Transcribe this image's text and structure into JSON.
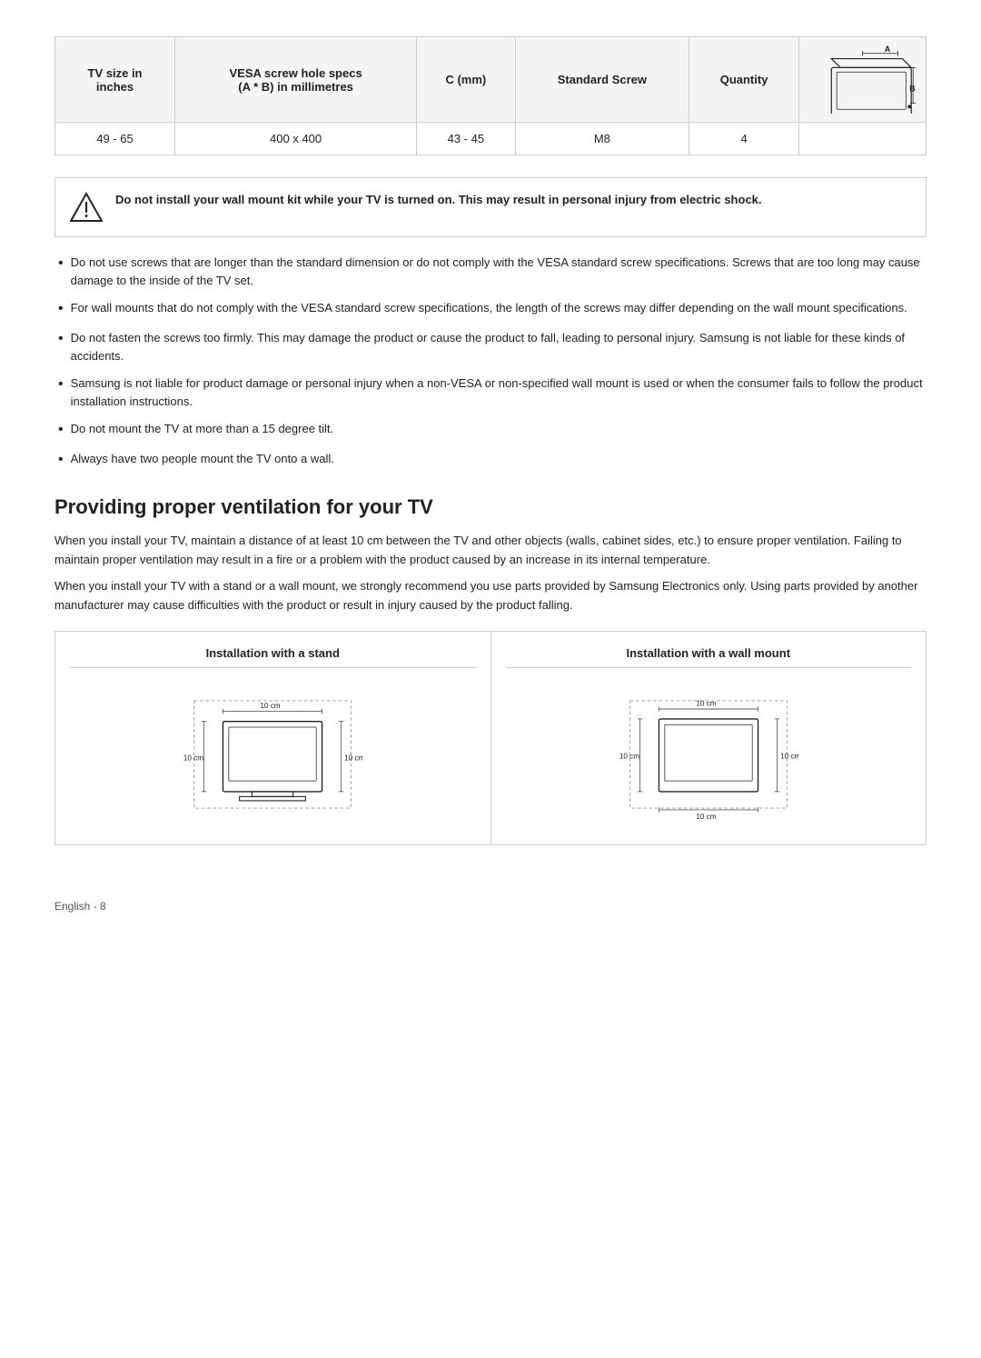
{
  "table": {
    "headers": [
      "TV size in\ninches",
      "VESA screw hole specs\n(A * B) in millimetres",
      "C (mm)",
      "Standard Screw",
      "Quantity",
      "Diagram"
    ],
    "rows": [
      {
        "tv_size": "49 - 65",
        "vesa_spec": "400 x 400",
        "c_mm": "43 - 45",
        "standard_screw": "M8",
        "quantity": "4"
      }
    ]
  },
  "warning": {
    "text_bold": "Do not install your wall mount kit while your TV is turned on. This may result in personal injury from electric shock."
  },
  "bullets": [
    "Do not use screws that are longer than the standard dimension or do not comply with the VESA standard screw specifications. Screws that are too long may cause damage to the inside of the TV set.",
    "For wall mounts that do not comply with the VESA standard screw specifications, the length of the screws may differ depending on the wall mount specifications.",
    "Do not fasten the screws too firmly. This may damage the product or cause the product to fall, leading to personal injury. Samsung is not liable for these kinds of accidents.",
    "Samsung is not liable for product damage or personal injury when a non-VESA or non-specified wall mount is used or when the consumer fails to follow the product installation instructions.",
    "Do not mount the TV at more than a 15 degree tilt.",
    "Always have two people mount the TV onto a wall."
  ],
  "ventilation_section": {
    "heading": "Providing proper ventilation for your TV",
    "para1": "When you install your TV, maintain a distance of at least 10 cm between the TV and other objects (walls, cabinet sides, etc.) to ensure proper ventilation. Failing to maintain proper ventilation may result in a fire or a problem with the product caused by an increase in its internal temperature.",
    "para2": "When you install your TV with a stand or a wall mount, we strongly recommend you use parts provided by Samsung Electronics only. Using parts provided by another manufacturer may cause difficulties with the product or result in injury caused by the product falling.",
    "diagrams": [
      {
        "title": "Installation with a stand",
        "labels": {
          "top": "10 cm",
          "left": "10 cm",
          "right": "10 cm"
        }
      },
      {
        "title": "Installation with a wall mount",
        "labels": {
          "top": "10 cm",
          "left": "10 cm",
          "right": "10 cm",
          "bottom": "10 cm"
        }
      }
    ]
  },
  "footer": {
    "text": "English - 8"
  }
}
